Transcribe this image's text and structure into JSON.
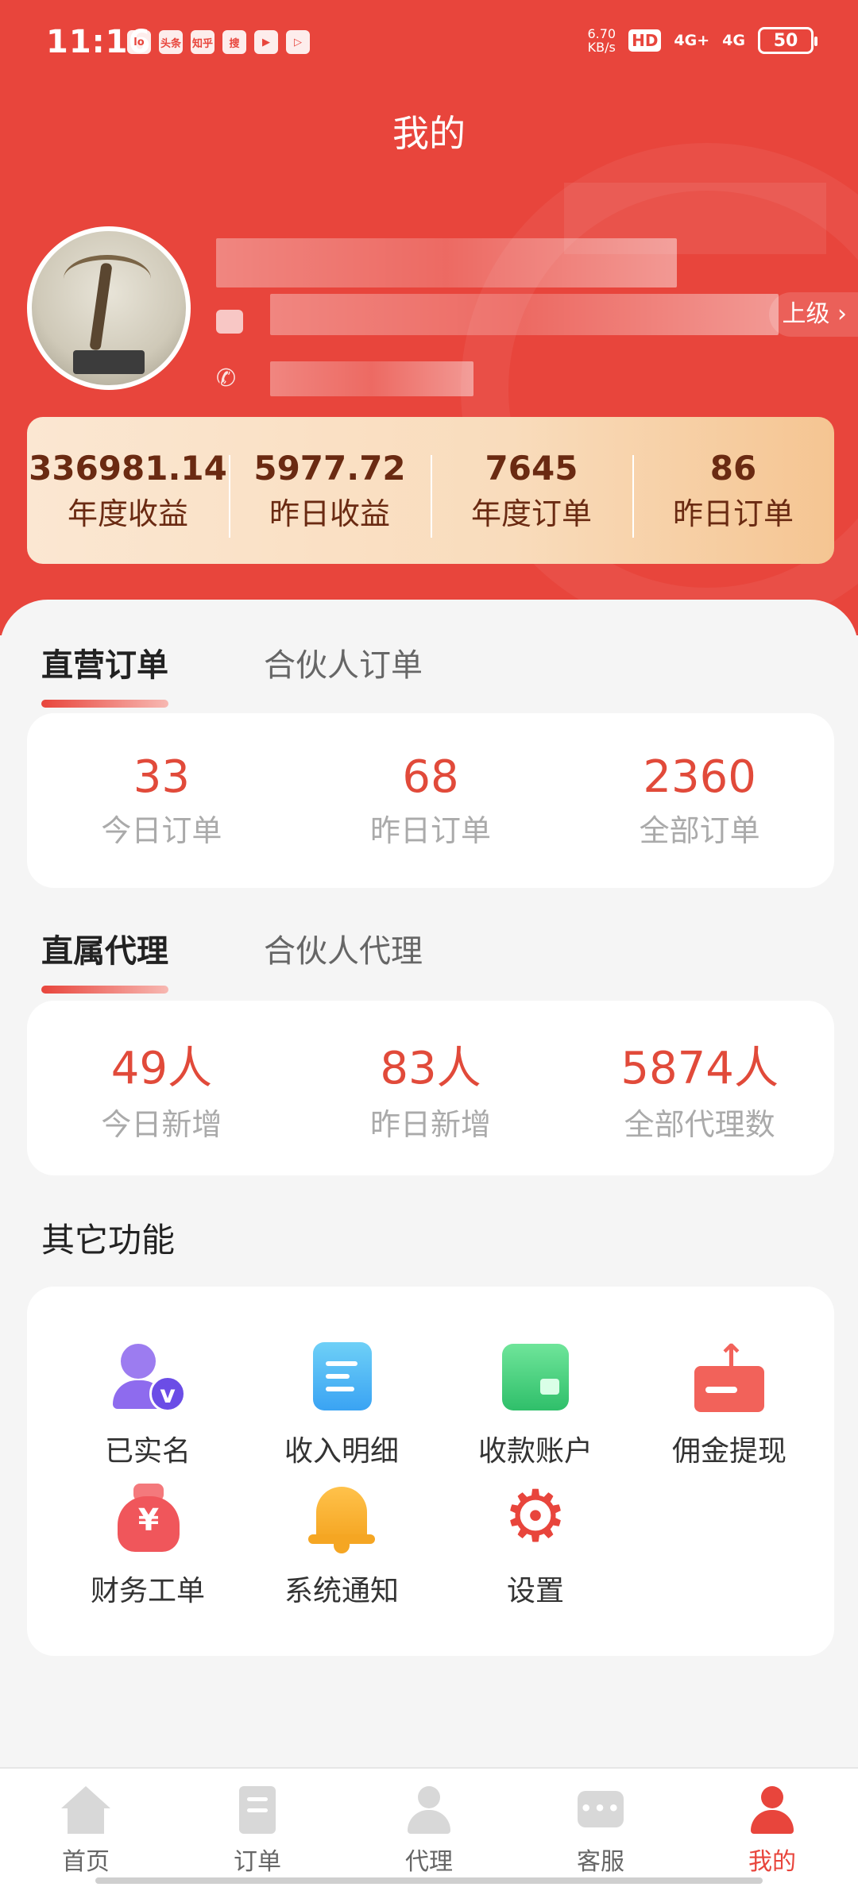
{
  "status_bar": {
    "time": "11:16",
    "apps": [
      "lo",
      "头条",
      "知乎",
      "搜",
      "▶",
      "▷"
    ],
    "net_speed_value": "6.70",
    "net_speed_unit": "KB/s",
    "hd": "HD",
    "signal_1": "4G+",
    "signal_2": "4G",
    "battery": "50"
  },
  "page_title": "我的",
  "profile": {
    "upper_label": "上级",
    "upper_chevron": "›"
  },
  "stats": [
    {
      "value": "336981.14",
      "label": "年度收益"
    },
    {
      "value": "5977.72",
      "label": "昨日收益"
    },
    {
      "value": "7645",
      "label": "年度订单"
    },
    {
      "value": "86",
      "label": "昨日订单"
    }
  ],
  "orders": {
    "tabs": [
      "直营订单",
      "合伙人订单"
    ],
    "items": [
      {
        "value": "33",
        "label": "今日订单"
      },
      {
        "value": "68",
        "label": "昨日订单"
      },
      {
        "value": "2360",
        "label": "全部订单"
      }
    ]
  },
  "agents": {
    "tabs": [
      "直属代理",
      "合伙人代理"
    ],
    "items": [
      {
        "value": "49人",
        "label": "今日新增"
      },
      {
        "value": "83人",
        "label": "昨日新增"
      },
      {
        "value": "5874人",
        "label": "全部代理数"
      }
    ]
  },
  "functions": {
    "title": "其它功能",
    "items": [
      {
        "label": "已实名",
        "icon": "verified-user-icon"
      },
      {
        "label": "收入明细",
        "icon": "income-detail-icon"
      },
      {
        "label": "收款账户",
        "icon": "wallet-icon"
      },
      {
        "label": "佣金提现",
        "icon": "withdraw-icon"
      },
      {
        "label": "财务工单",
        "icon": "money-bag-icon"
      },
      {
        "label": "系统通知",
        "icon": "bell-icon"
      },
      {
        "label": "设置",
        "icon": "gear-icon"
      }
    ],
    "yen": "¥",
    "verified_mark": "v"
  },
  "bottom_nav": [
    {
      "label": "首页",
      "icon": "home-icon"
    },
    {
      "label": "订单",
      "icon": "order-icon"
    },
    {
      "label": "代理",
      "icon": "agent-icon"
    },
    {
      "label": "客服",
      "icon": "service-icon"
    },
    {
      "label": "我的",
      "icon": "profile-icon"
    }
  ],
  "colors": {
    "brand_red": "#e8453c",
    "number_red": "#e14a3a",
    "stats_brown": "#6a2a12"
  }
}
